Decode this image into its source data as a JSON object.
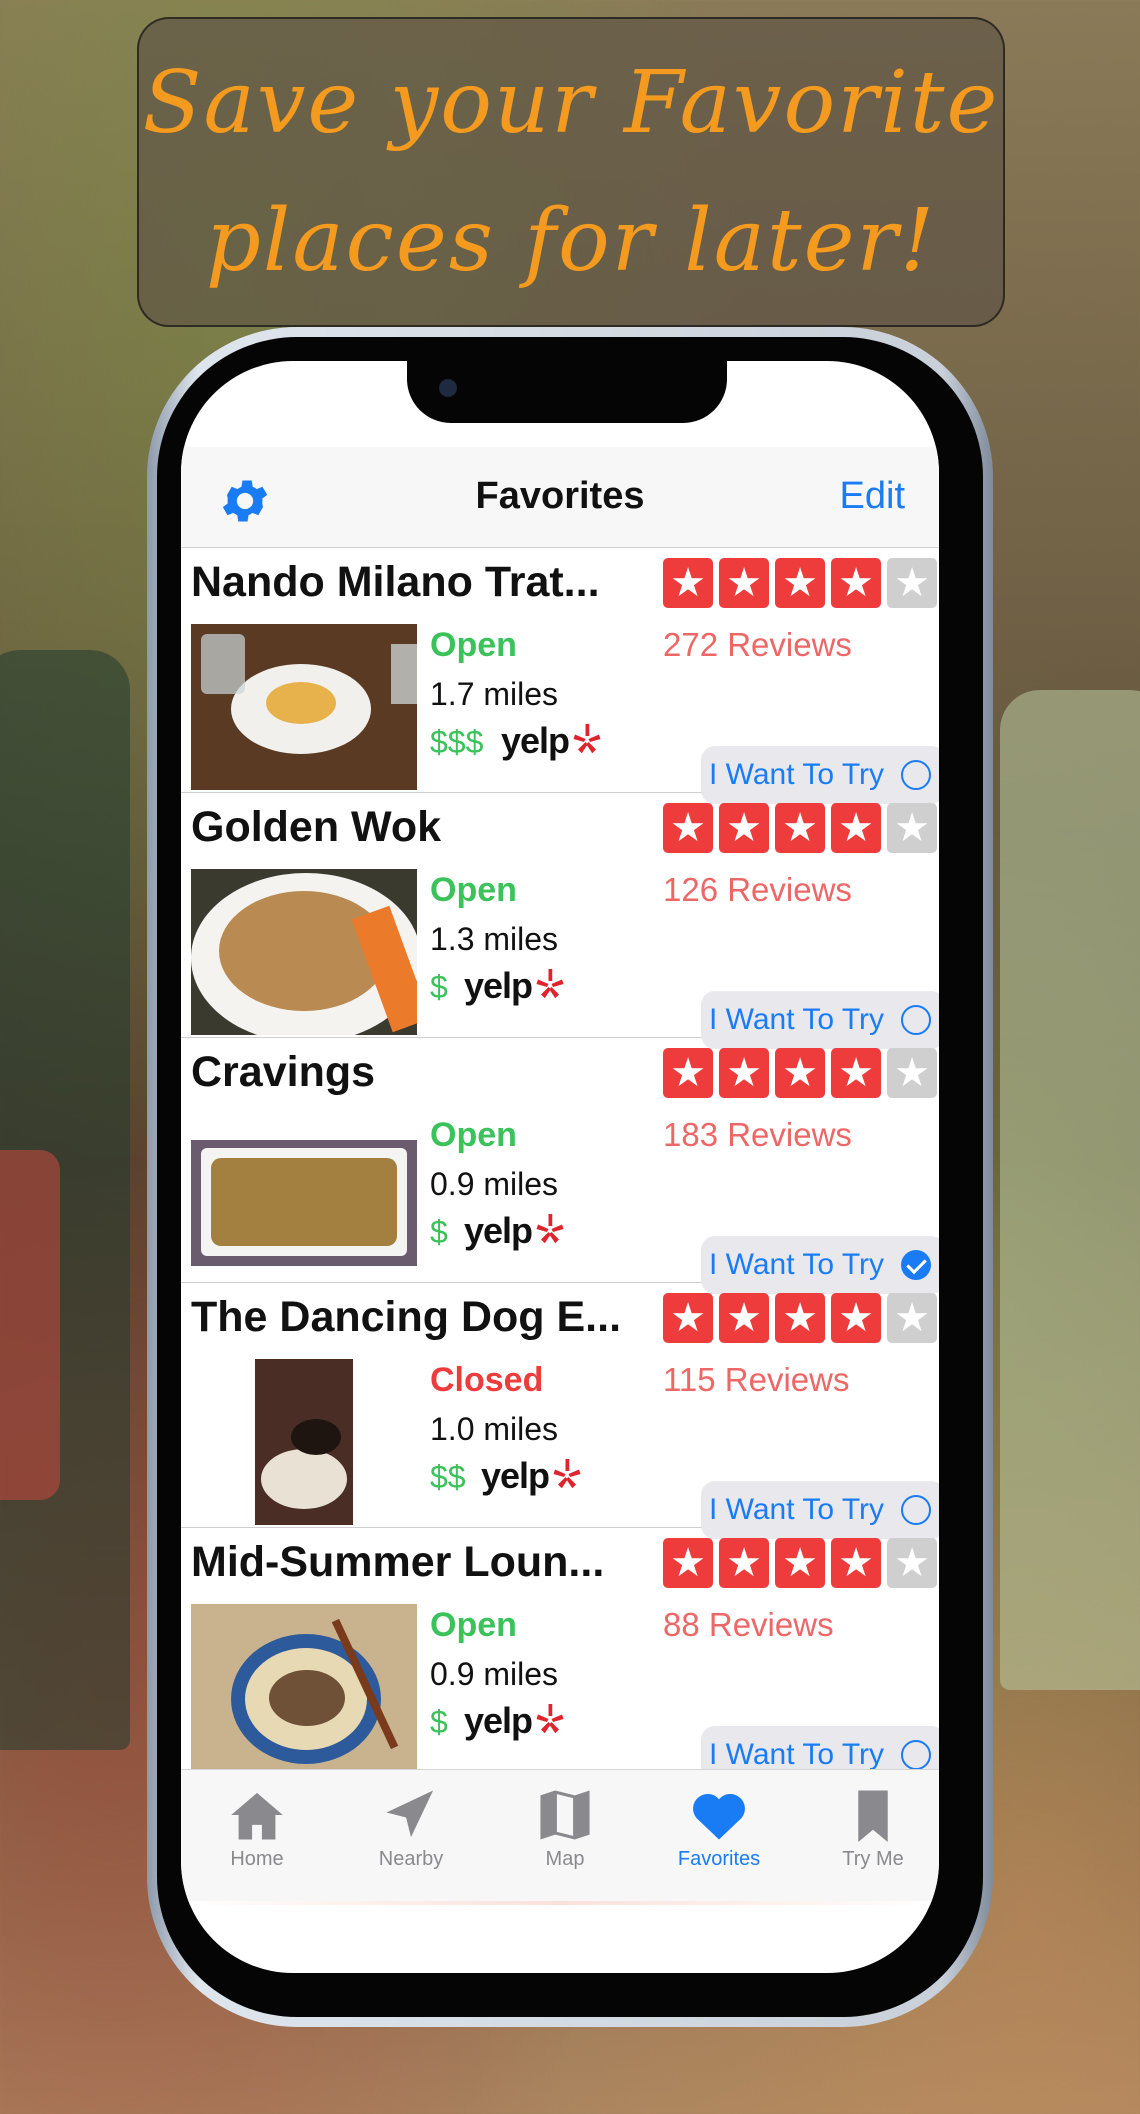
{
  "promo": {
    "line1": "Save your Favorite",
    "line2": "places for later!"
  },
  "navbar": {
    "title": "Favorites",
    "edit_label": "Edit",
    "settings_icon": "gear-icon"
  },
  "colors": {
    "accent": "#1a7cf5",
    "star_red": "#ee3b3b",
    "open_green": "#3cc25a",
    "closed_red": "#ee3b3b",
    "reviews": "#ee6767"
  },
  "restaurants": [
    {
      "name": "Nando Milano Trat...",
      "rating": 4,
      "reviews": "272 Reviews",
      "status": "Open",
      "distance": "1.7 miles",
      "price": "$$$",
      "brand": "yelp",
      "try_label": "I Want To Try",
      "try_checked": false
    },
    {
      "name": "Golden Wok",
      "rating": 4,
      "reviews": "126 Reviews",
      "status": "Open",
      "distance": "1.3 miles",
      "price": "$",
      "brand": "yelp",
      "try_label": "I Want To Try",
      "try_checked": false
    },
    {
      "name": "Cravings",
      "rating": 4,
      "reviews": "183 Reviews",
      "status": "Open",
      "distance": "0.9 miles",
      "price": "$",
      "brand": "yelp",
      "try_label": "I Want To Try",
      "try_checked": true
    },
    {
      "name": "The Dancing Dog E...",
      "rating": 4,
      "reviews": "115 Reviews",
      "status": "Closed",
      "distance": "1.0 miles",
      "price": "$$",
      "brand": "yelp",
      "try_label": "I Want To Try",
      "try_checked": false
    },
    {
      "name": "Mid-Summer Loun...",
      "rating": 4,
      "reviews": "88 Reviews",
      "status": "Open",
      "distance": "0.9 miles",
      "price": "$",
      "brand": "yelp",
      "try_label": "I Want To Try",
      "try_checked": false
    }
  ],
  "tabbar": {
    "tabs": [
      {
        "label": "Home",
        "icon": "house-icon",
        "active": false
      },
      {
        "label": "Nearby",
        "icon": "location-arrow-icon",
        "active": false
      },
      {
        "label": "Map",
        "icon": "map-icon",
        "active": false
      },
      {
        "label": "Favorites",
        "icon": "heart-icon",
        "active": true
      },
      {
        "label": "Try Me",
        "icon": "bookmark-icon",
        "active": false
      }
    ]
  }
}
